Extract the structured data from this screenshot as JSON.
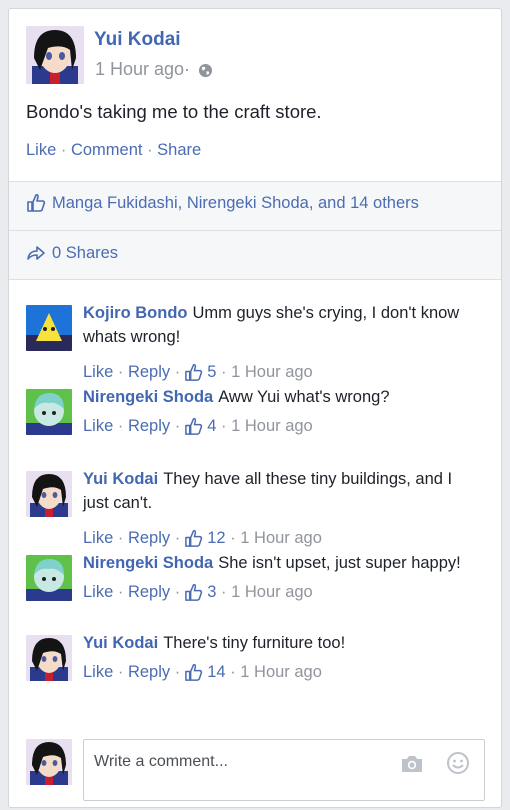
{
  "post": {
    "author": "Yui Kodai",
    "time": "1 Hour ago·",
    "text": "Bondo's taking me to the craft store.",
    "actions": {
      "like": "Like",
      "comment": "Comment",
      "share": "Share",
      "sep": " · "
    }
  },
  "likes": {
    "text": "Manga Fukidashi, Nirengeki Shoda, and 14 others"
  },
  "shares": {
    "text": "0 Shares"
  },
  "comments": [
    {
      "name": "Kojiro Bondo",
      "text": "Umm guys she's crying, I don't know whats wrong!",
      "like": "Like",
      "reply": "Reply",
      "likes": "5",
      "time": "1 Hour ago",
      "avatar": "yellow"
    },
    {
      "name": "Nirengeki Shoda",
      "text": "Aww Yui what's wrong?",
      "like": "Like",
      "reply": "Reply",
      "likes": "4",
      "time": "1 Hour ago",
      "avatar": "teal"
    },
    {
      "name": "Yui Kodai",
      "text": "They have all these tiny buildings, and I just can't.",
      "like": "Like",
      "reply": "Reply",
      "likes": "12",
      "time": "1 Hour ago",
      "avatar": "dark"
    },
    {
      "name": "Nirengeki Shoda",
      "text": "She isn't upset, just super happy!",
      "like": "Like",
      "reply": "Reply",
      "likes": "3",
      "time": "1 Hour ago",
      "avatar": "teal"
    },
    {
      "name": "Yui Kodai",
      "text": "There's tiny furniture too!",
      "like": "Like",
      "reply": "Reply",
      "likes": "14",
      "time": "1 Hour ago",
      "avatar": "dark"
    }
  ],
  "composer": {
    "placeholder": "Write a comment..."
  },
  "colors": {
    "link": "#4b6cb3",
    "name": "#4267b2",
    "meta": "#90949c"
  }
}
